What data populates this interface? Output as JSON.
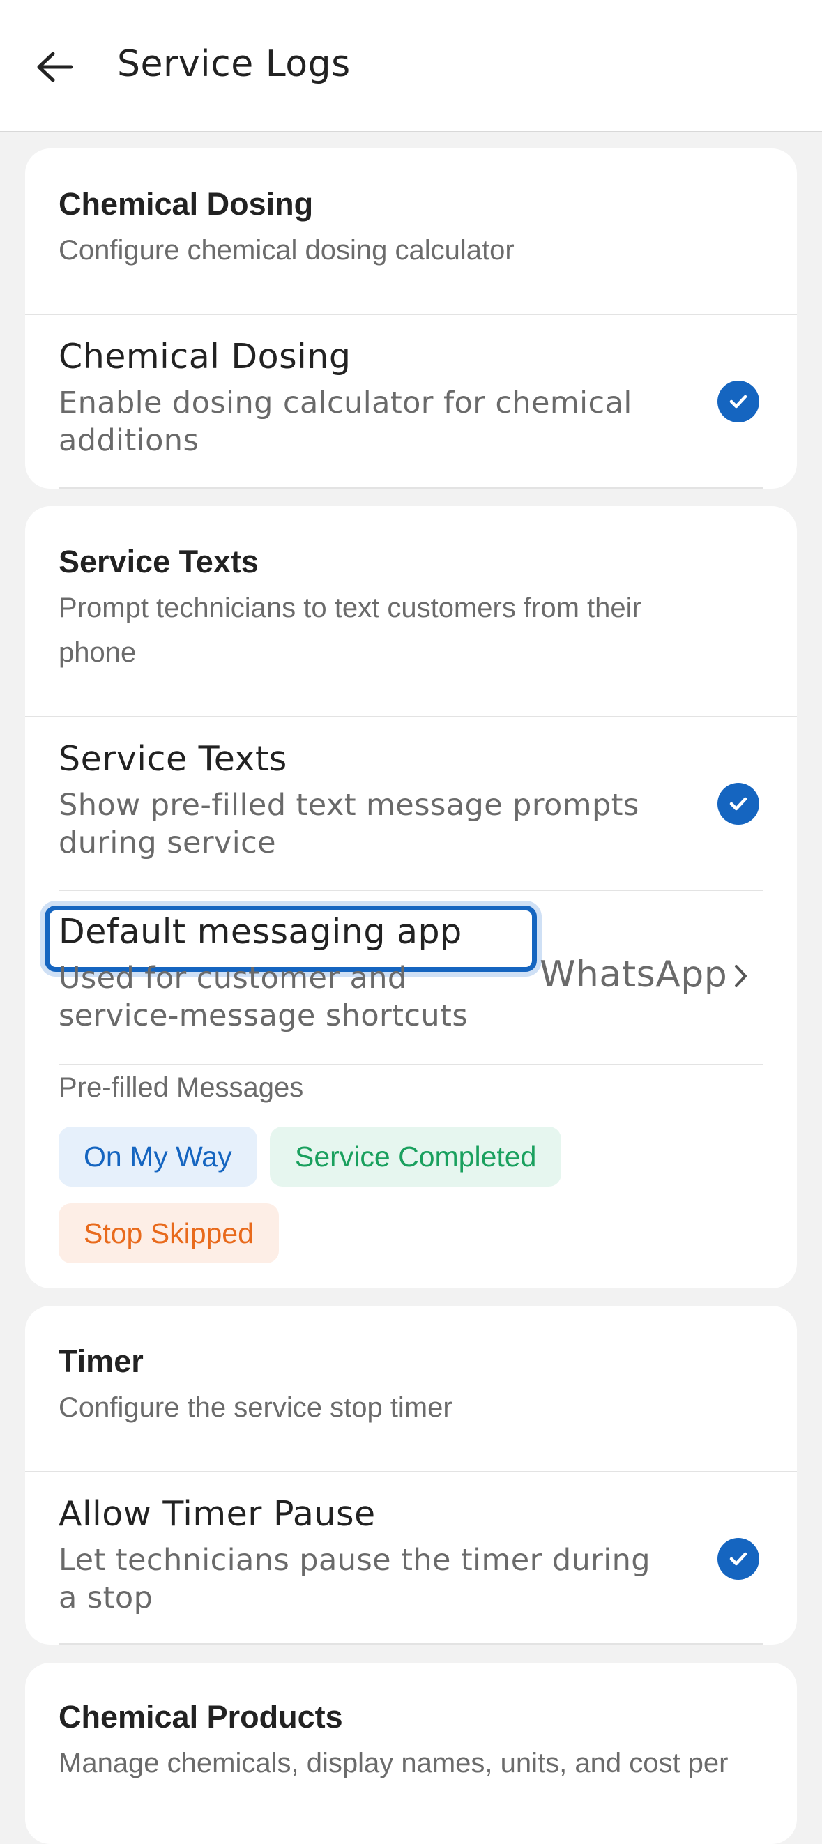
{
  "header": {
    "title": "Service Logs"
  },
  "cards": {
    "chemical_dosing": {
      "title": "Chemical Dosing",
      "description": "Configure chemical dosing calculator",
      "row": {
        "title": "Chemical Dosing",
        "subtitle_line1": "Enable dosing calculator for chemical",
        "subtitle_line2": "additions",
        "checked": true
      }
    },
    "service_texts": {
      "title": "Service Texts",
      "description_line1": "Prompt technicians to text customers from their",
      "description_line2": "phone",
      "row": {
        "title": "Service Texts",
        "subtitle_line1": "Show pre-filled text message prompts",
        "subtitle_line2": "during service",
        "checked": true
      },
      "messaging_app": {
        "title": "Default messaging app",
        "subtitle_line1": "Used for customer and",
        "subtitle_line2": "service-message shortcuts",
        "value": "WhatsApp"
      },
      "prefilled_label": "Pre-filled Messages",
      "chips": [
        "On My Way",
        "Service Completed",
        "Stop Skipped"
      ]
    },
    "timer": {
      "title": "Timer",
      "description": "Configure the service stop timer",
      "row": {
        "title": "Allow Timer Pause",
        "subtitle_line1": "Let technicians pause the timer during",
        "subtitle_line2": "a stop",
        "checked": true
      }
    },
    "chemical_products": {
      "title": "Chemical Products",
      "description": "Manage chemicals, display names, units, and cost per"
    }
  },
  "colors": {
    "accent": "#1565c0",
    "green": "#1aa05e",
    "orange": "#e86a1c"
  }
}
